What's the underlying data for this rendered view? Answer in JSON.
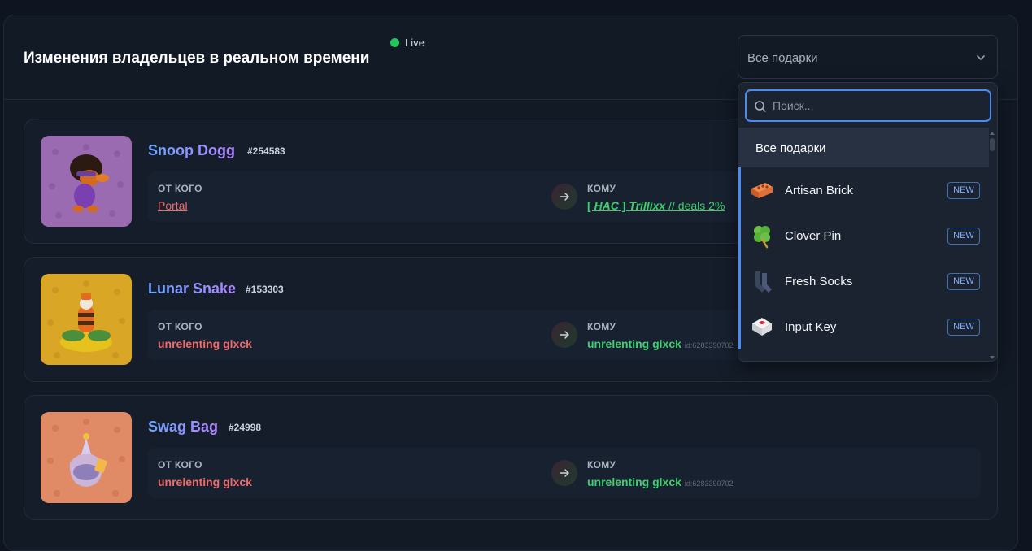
{
  "header": {
    "title": "Изменения владельцев в реальном времени",
    "live_label": "Live",
    "filter_value": "Все подарки"
  },
  "labels": {
    "from": "ОТ КОГО",
    "to": "КОМУ"
  },
  "transfers": [
    {
      "gift": "Snoop Dogg",
      "number": "#254583",
      "from": "Portal",
      "to_prefix": "[ ",
      "to_tag": "HAC",
      "to_mid": " ] ",
      "to_name": "Trillixx",
      "to_suffix": " // deals 2%",
      "to_id": ""
    },
    {
      "gift": "Lunar Snake",
      "number": "#153303",
      "from": "unrelenting glxck",
      "to": "unrelenting glxck",
      "to_id": "id:6283390702"
    },
    {
      "gift": "Swag Bag",
      "number": "#24998",
      "from": "unrelenting glxck",
      "to": "unrelenting glxck",
      "to_id": "id:6283390702"
    }
  ],
  "dropdown": {
    "search_placeholder": "Поиск...",
    "all_option": "Все подарки",
    "options": [
      {
        "label": "Artisan Brick",
        "badge": "NEW",
        "icon": "brick-icon"
      },
      {
        "label": "Clover Pin",
        "badge": "NEW",
        "icon": "clover-icon"
      },
      {
        "label": "Fresh Socks",
        "badge": "NEW",
        "icon": "socks-icon"
      },
      {
        "label": "Input Key",
        "badge": "NEW",
        "icon": "key-icon"
      }
    ]
  },
  "colors": {
    "accent": "#4c8cf0",
    "live": "#22c55e",
    "from": "#f06a6a",
    "to": "#3ecf6e"
  }
}
